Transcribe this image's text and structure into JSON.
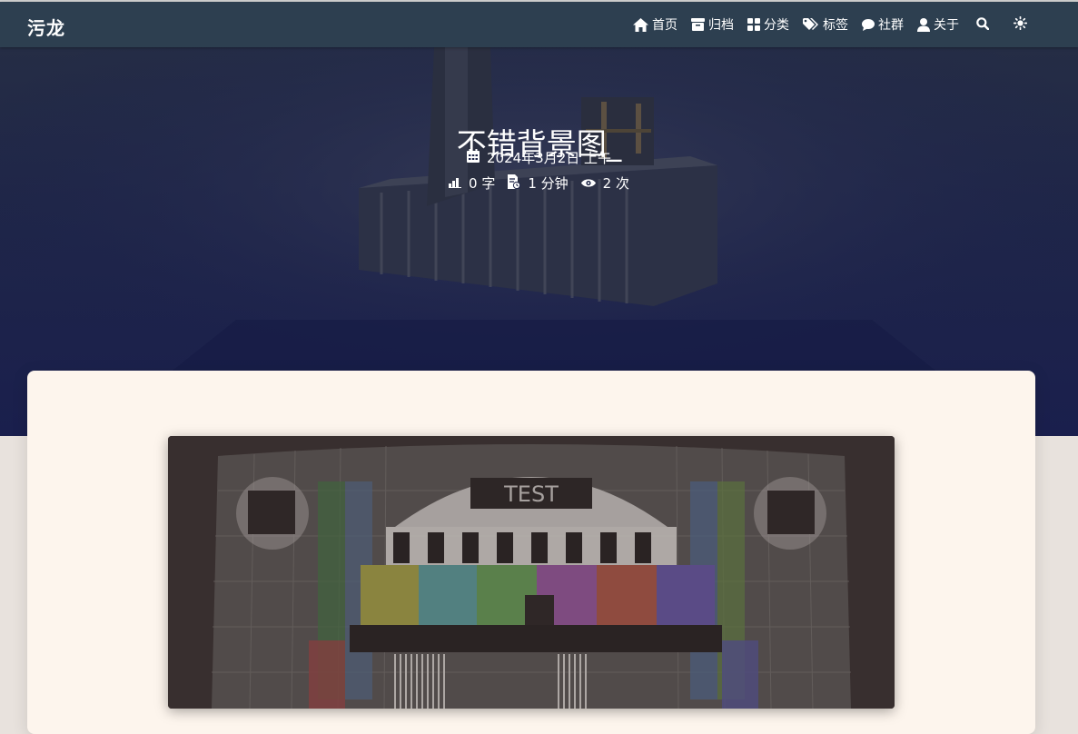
{
  "site": {
    "logo": "污龙"
  },
  "nav": {
    "items": [
      {
        "label": "首页",
        "icon": "home-icon"
      },
      {
        "label": "归档",
        "icon": "archive-icon"
      },
      {
        "label": "分类",
        "icon": "category-icon"
      },
      {
        "label": "标签",
        "icon": "tags-icon"
      },
      {
        "label": "社群",
        "icon": "chat-icon"
      },
      {
        "label": "关于",
        "icon": "user-icon"
      }
    ],
    "search_icon": "search-icon",
    "theme_icon": "sun-icon"
  },
  "post": {
    "title": "不错背景图_",
    "date": "2024年3月2日 上午",
    "word_count": "0 字",
    "read_time": "1 分钟",
    "views": "2 次"
  },
  "content": {
    "image_text": "TEST"
  },
  "colors": {
    "navbar": "#2d3f50",
    "hero": "#1f2648",
    "card": "#fdf5ed",
    "page_bg": "#e8e2dd"
  }
}
